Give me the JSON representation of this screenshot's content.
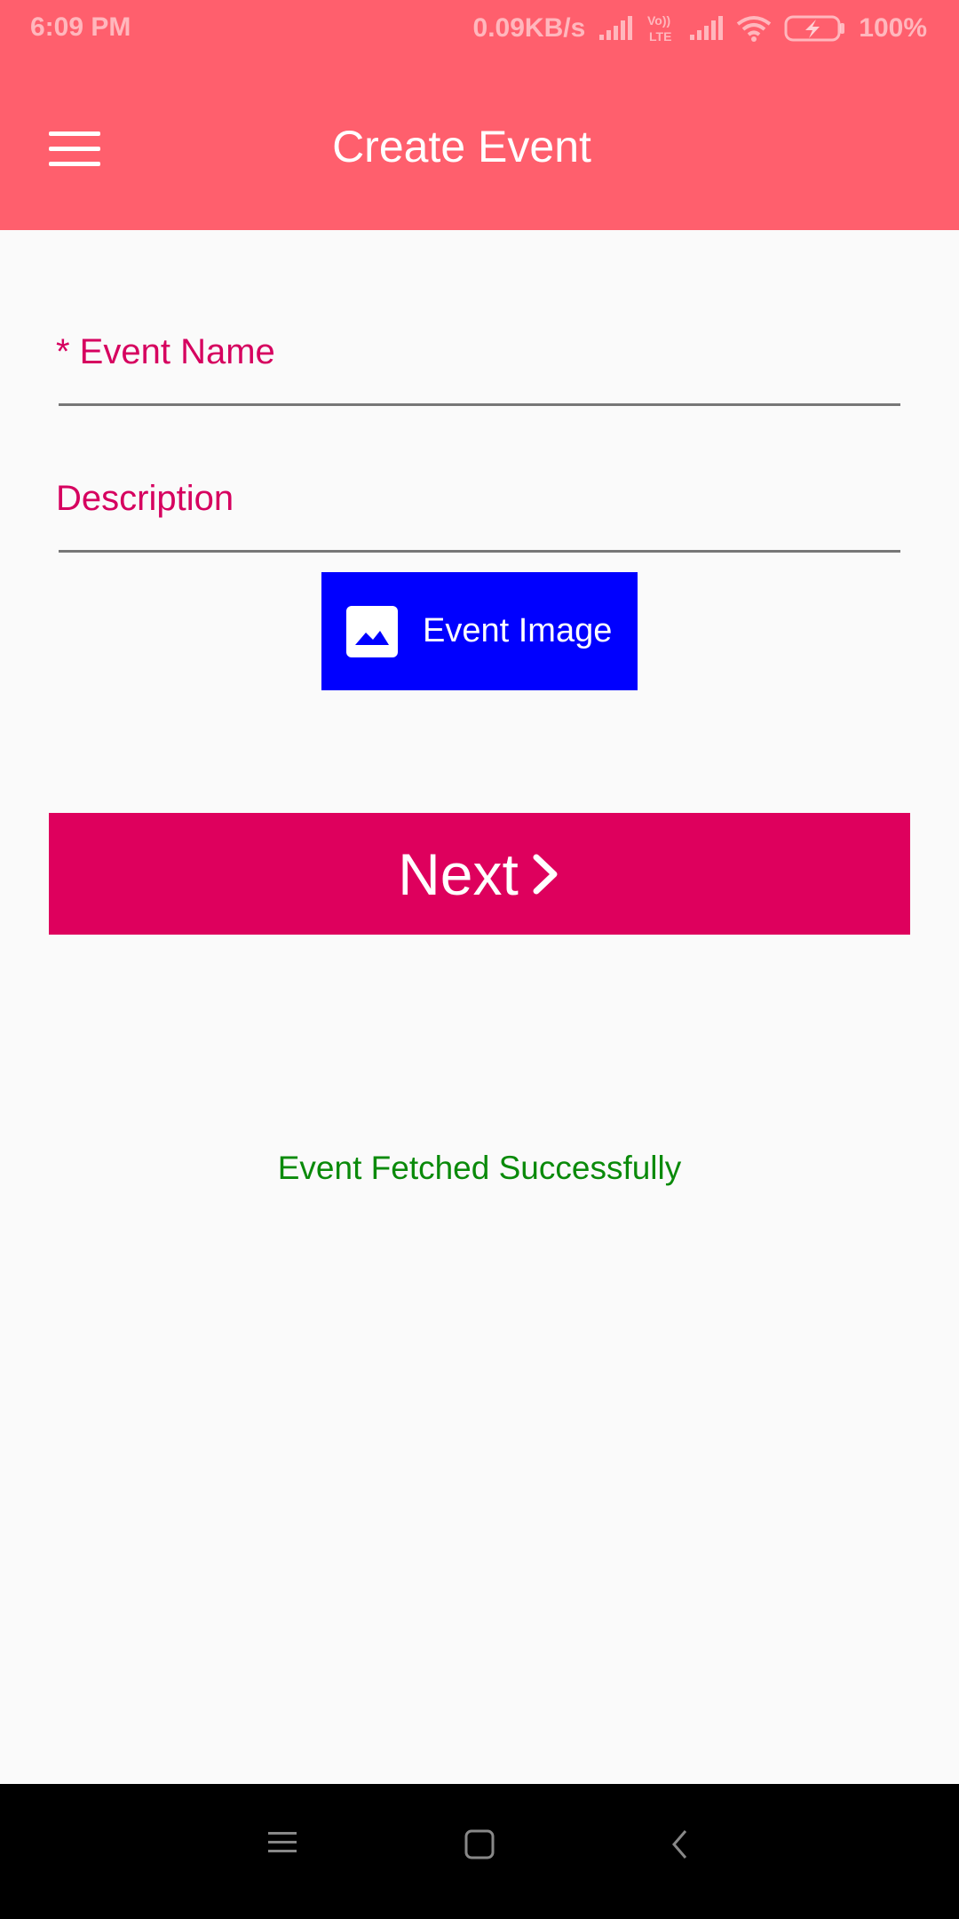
{
  "status_bar": {
    "time": "6:09 PM",
    "network_speed": "0.09KB/s",
    "volte_label_top": "Vo))",
    "volte_label_bottom": "LTE",
    "battery": "100%"
  },
  "app_bar": {
    "title": "Create Event",
    "menu_icon": "hamburger-menu-icon",
    "background_color": "#ff5f6d"
  },
  "form": {
    "event_name": {
      "label": "* Event Name",
      "value": ""
    },
    "description": {
      "label": "Description",
      "value": ""
    },
    "image_button": {
      "label": "Event Image",
      "icon": "image-icon",
      "background_color": "#0000ff"
    },
    "next_button": {
      "label": "Next",
      "icon": "chevron-right-icon",
      "background_color": "#de005d"
    }
  },
  "status_message": {
    "text": "Event Fetched Successfully",
    "color": "#0a8a0a"
  },
  "nav_bar": {
    "recents_icon": "menu-lines-icon",
    "home_icon": "home-square-icon",
    "back_icon": "back-chevron-icon"
  },
  "colors": {
    "label_accent": "#d6005f"
  }
}
